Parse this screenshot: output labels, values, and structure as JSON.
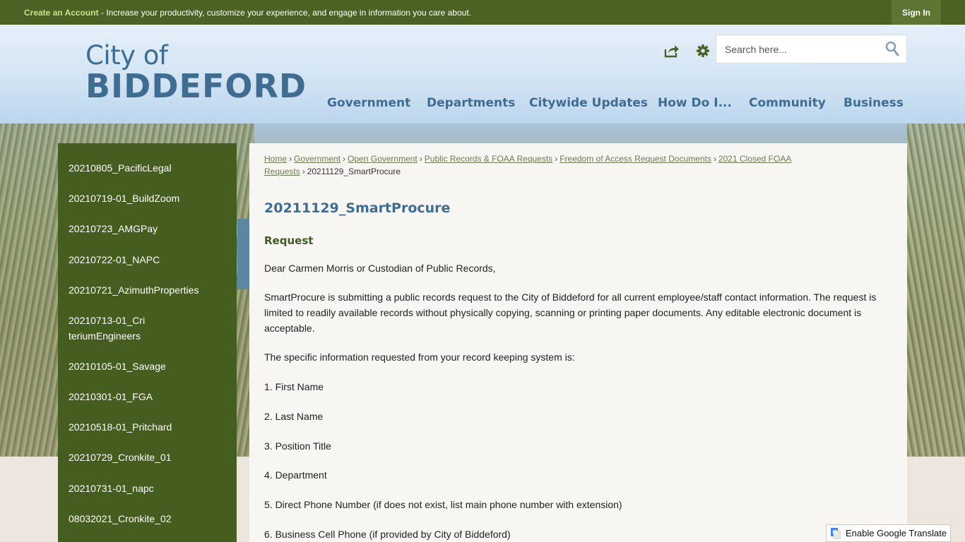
{
  "topbar": {
    "create_link": "Create an Account",
    "message": " - Increase your productivity, customize your experience, and engage in information you care about.",
    "signin_label": "Sign In"
  },
  "logo": {
    "line1": "City of",
    "line2": "BIDDEFORD"
  },
  "icons": {
    "share": "share-icon",
    "settings": "gear-icon",
    "search": "search-icon",
    "translate": "google-translate-icon"
  },
  "search": {
    "placeholder": "Search here..."
  },
  "nav": [
    {
      "label": "Government"
    },
    {
      "label": "Departments"
    },
    {
      "label": "Citywide Updates"
    },
    {
      "label": "How Do I..."
    },
    {
      "label": "Community"
    },
    {
      "label": "Business"
    }
  ],
  "sidebar": {
    "items": [
      "20210805_PacificLegal",
      "20210719-01_BuildZoom",
      "20210723_AMGPay",
      "20210722-01_NAPC",
      "20210721_AzimuthProperties",
      "20210713-01_CriteriumEngineers",
      "20210105-01_Savage",
      "20210301-01_FGA",
      "20210518-01_Pritchard",
      "20210729_Cronkite_01",
      "20210731-01_napc",
      "08032021_Cronkite_02"
    ]
  },
  "breadcrumb": {
    "links": [
      "Home",
      "Government",
      "Open Government",
      "Public Records & FOAA Requests",
      "Freedom of Access Request Documents",
      "2021 Closed FOAA Requests"
    ],
    "current": "20211129_SmartProcure",
    "separator": "›"
  },
  "page": {
    "title": "20211129_SmartProcure",
    "subheading": "Request",
    "paragraphs": [
      "Dear Carmen Morris or Custodian of Public Records,",
      "SmartProcure is submitting a public records request to the City of Biddeford for all current employee/staff contact information. The request is limited to readily available records without physically copying, scanning or printing paper documents. Any editable electronic document is acceptable.",
      "The specific information requested from your record keeping system is:",
      "1. First Name",
      "2. Last Name",
      "3. Position Title",
      "4. Department",
      "5. Direct Phone Number (if does not exist, list main phone number with extension)",
      "6. Business Cell Phone (if provided by City of Biddeford)"
    ]
  },
  "translate": {
    "label": "Enable Google Translate"
  },
  "colors": {
    "top_bar": "#4a6324",
    "sidebar": "#465d20",
    "accent_blue": "#3f6d92",
    "link_green": "#6b7a52"
  }
}
